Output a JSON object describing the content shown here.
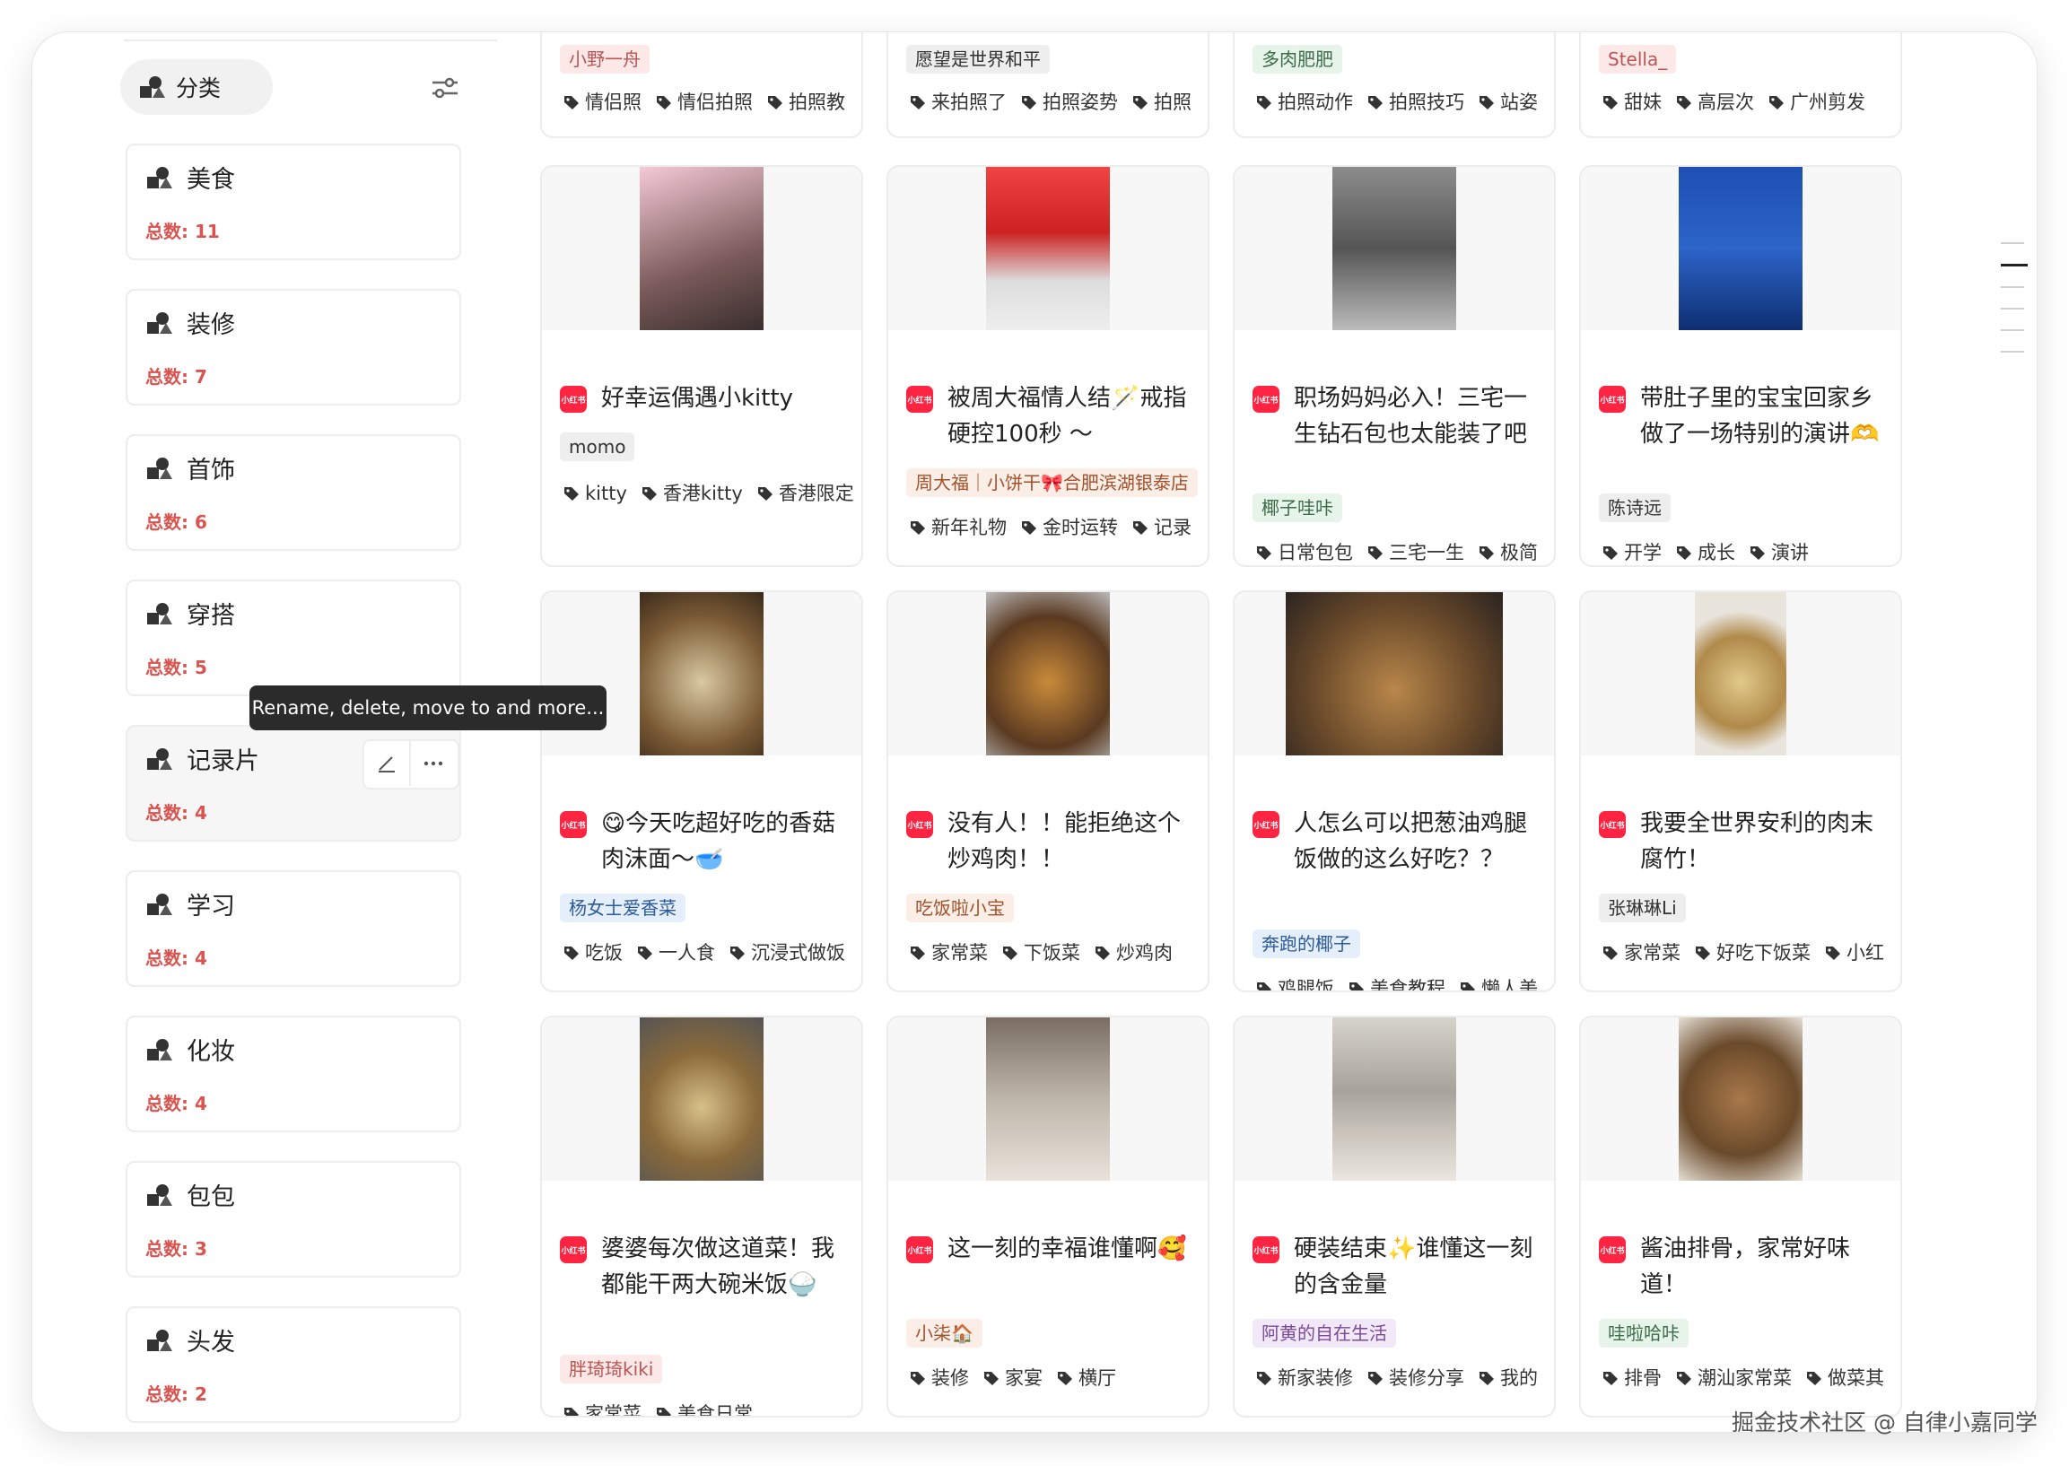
{
  "sidebar": {
    "header_label": "分类",
    "categories": [
      {
        "name": "美食",
        "count": "总数: 11"
      },
      {
        "name": "装修",
        "count": "总数: 7"
      },
      {
        "name": "首饰",
        "count": "总数: 6"
      },
      {
        "name": "穿搭",
        "count": "总数: 5"
      },
      {
        "name": "记录片",
        "count": "总数: 4"
      },
      {
        "name": "学习",
        "count": "总数: 4"
      },
      {
        "name": "化妆",
        "count": "总数: 4"
      },
      {
        "name": "包包",
        "count": "总数: 3"
      },
      {
        "name": "头发",
        "count": "总数: 2"
      }
    ],
    "tooltip": "Rename, delete, move to and more..."
  },
  "source_badge": "小红书",
  "posts_top": [
    {
      "author": "小野一舟",
      "author_color": "#fde8e8",
      "tags": [
        "情侣照",
        "情侣拍照",
        "拍照教"
      ]
    },
    {
      "author": "愿望是世界和平",
      "author_color": "#eeeeee",
      "tags": [
        "来拍照了",
        "拍照姿势",
        "拍照"
      ]
    },
    {
      "author": "多肉肥肥",
      "author_color": "#e6f4ea",
      "tags": [
        "拍照动作",
        "拍照技巧",
        "站姿"
      ]
    },
    {
      "author": "Stella_",
      "author_color": "#fde8e8",
      "tags": [
        "甜妹",
        "高层次",
        "广州剪发"
      ]
    }
  ],
  "posts": [
    {
      "title": "好幸运偶遇小kitty",
      "author": "momo",
      "author_color": "#eeeeee",
      "tags": [
        "kitty",
        "香港kitty",
        "香港限定"
      ]
    },
    {
      "title": "被周大福情人结🪄戒指硬控100秒 ～",
      "author": "周大福｜小饼干🎀合肥滨湖银泰店",
      "author_color": "#fbeee6",
      "tags": [
        "新年礼物",
        "金时运转",
        "记录"
      ]
    },
    {
      "title": "职场妈妈必入！三宅一生钻石包也太能装了吧",
      "author": "椰子哇咔",
      "author_color": "#e6f4ea",
      "tags": [
        "日常包包",
        "三宅一生",
        "极简"
      ]
    },
    {
      "title": "带肚子里的宝宝回家乡做了一场特别的演讲🫶",
      "author": "陈诗远",
      "author_color": "#eeeeee",
      "tags": [
        "开学",
        "成长",
        "演讲"
      ]
    },
    {
      "title": "😋今天吃超好吃的香菇肉沫面～🥣",
      "author": "杨女士爱香菜",
      "author_color": "#e5effb",
      "tags": [
        "吃饭",
        "一人食",
        "沉浸式做饭"
      ]
    },
    {
      "title": "没有人！！能拒绝这个炒鸡肉！！",
      "author": "吃饭啦小宝",
      "author_color": "#fbeee6",
      "tags": [
        "家常菜",
        "下饭菜",
        "炒鸡肉"
      ]
    },
    {
      "title": "人怎么可以把葱油鸡腿饭做的这么好吃？？",
      "author": "奔跑的椰子",
      "author_color": "#e5effb",
      "tags": [
        "鸡腿饭",
        "美食教程",
        "懒人美"
      ]
    },
    {
      "title": "我要全世界安利的肉末腐竹！",
      "author": "张琳琳Li",
      "author_color": "#eeeeee",
      "tags": [
        "家常菜",
        "好吃下饭菜",
        "小红"
      ]
    },
    {
      "title": "婆婆每次做这道菜！我都能干两大碗米饭🍚",
      "author": "胖琦琦kiki",
      "author_color": "#fde8e8",
      "tags": [
        "家常菜",
        "美食日常"
      ]
    },
    {
      "title": "这一刻的幸福谁懂啊🥰",
      "author": "小柒🏠",
      "author_color": "#fbeee6",
      "tags": [
        "装修",
        "家宴",
        "横厅"
      ]
    },
    {
      "title": "硬装结束✨谁懂这一刻的含金量",
      "author": "阿黄的自在生活",
      "author_color": "#f1e8f8",
      "tags": [
        "新家装修",
        "装修分享",
        "我的"
      ]
    },
    {
      "title": "酱油排骨，家常好味道！",
      "author": "哇啦哈咔",
      "author_color": "#e6f4ea",
      "tags": [
        "排骨",
        "潮汕家常菜",
        "做菜其"
      ]
    }
  ],
  "watermark": "掘金技术社区 @ 自律小嘉同学"
}
